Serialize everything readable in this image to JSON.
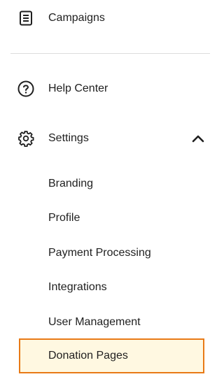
{
  "nav": {
    "campaigns": {
      "label": "Campaigns",
      "icon": "campaigns-icon"
    },
    "help_center": {
      "label": "Help Center",
      "icon": "help-circle-icon"
    },
    "settings": {
      "label": "Settings",
      "icon": "gear-icon",
      "expanded": true
    }
  },
  "settings_submenu": [
    {
      "label": "Branding"
    },
    {
      "label": "Profile"
    },
    {
      "label": "Payment Processing"
    },
    {
      "label": "Integrations"
    },
    {
      "label": "User Management"
    },
    {
      "label": "Donation Pages",
      "active": true
    }
  ],
  "colors": {
    "active_border": "#e87a16",
    "active_background": "#fff8e1"
  }
}
